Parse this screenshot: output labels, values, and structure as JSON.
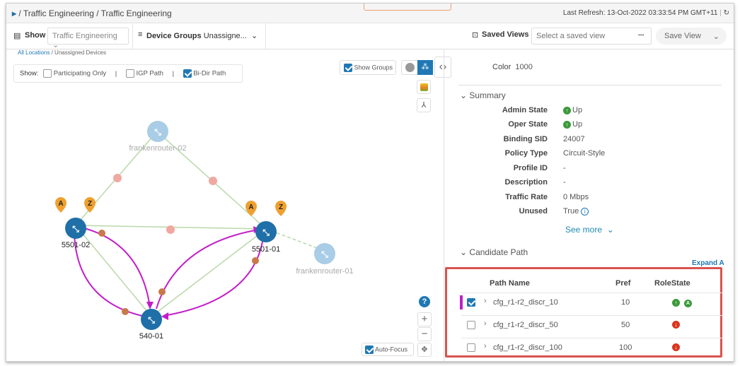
{
  "header": {
    "breadcrumb": "/ Traffic Engineering / Traffic Engineering",
    "last_refresh": "Last Refresh: 13-Oct-2022 03:33:54 PM GMT+11"
  },
  "toolbar": {
    "show_label": "Show",
    "show_value": "Traffic Engineering",
    "groups_label": "Device Groups",
    "groups_value": "Unassigne...",
    "saved_views_label": "Saved Views",
    "saved_view_placeholder": "Select a saved view",
    "more": "•••",
    "save_view": "Save View"
  },
  "location": {
    "root": "All Locations",
    "current": "/ Unassigned Devices"
  },
  "filters": {
    "label": "Show:",
    "items": [
      {
        "label": "Participating Only",
        "checked": false
      },
      {
        "label": "IGP Path",
        "checked": false
      },
      {
        "label": "Bi-Dir Path",
        "checked": true
      }
    ]
  },
  "map": {
    "show_groups": "Show Groups",
    "show_groups_checked": true,
    "auto_focus": "Auto-Focus",
    "auto_focus_checked": true,
    "help": "?",
    "zoom_in": "+",
    "zoom_out": "−",
    "nodes": [
      {
        "name": "frankenrouter-02",
        "status": "unreachable"
      },
      {
        "name": "5501-02",
        "markers": [
          "A",
          "Z"
        ]
      },
      {
        "name": "5501-01",
        "markers": [
          "A",
          "Z"
        ]
      },
      {
        "name": "frankenrouter-01",
        "status": "unreachable"
      },
      {
        "name": "540-01"
      }
    ],
    "colors": {
      "path": "#c21ec8",
      "link": "#b9d8a8",
      "node": "#1f6fa8",
      "node_dim": "#a9cde6",
      "marker": "#f0a030",
      "link_down": "#f0a8a0"
    }
  },
  "detail": {
    "color_label": "Color",
    "color_value": "1000",
    "summary_title": "Summary",
    "summary": [
      {
        "k": "Admin State",
        "v": "Up",
        "icon": "up"
      },
      {
        "k": "Oper State",
        "v": "Up",
        "icon": "up"
      },
      {
        "k": "Binding SID",
        "v": "24007"
      },
      {
        "k": "Policy Type",
        "v": "Circuit-Style"
      },
      {
        "k": "Profile ID",
        "v": "-"
      },
      {
        "k": "Description",
        "v": "-"
      },
      {
        "k": "Traffic Rate",
        "v": "0 Mbps"
      },
      {
        "k": "Unused",
        "v": "True",
        "icon": "info"
      }
    ],
    "see_more": "See more",
    "candidate_title": "Candidate Path",
    "expand_all": "Expand A",
    "columns": [
      "Path Name",
      "Pref",
      "RoleState"
    ],
    "rows": [
      {
        "name": "cfg_r1-r2_discr_10",
        "pref": "10",
        "checked": true,
        "state": [
          "up",
          "active"
        ],
        "active_letter": "A"
      },
      {
        "name": "cfg_r1-r2_discr_50",
        "pref": "50",
        "checked": false,
        "state": [
          "down"
        ]
      },
      {
        "name": "cfg_r1-r2_discr_100",
        "pref": "100",
        "checked": false,
        "state": [
          "down"
        ]
      }
    ]
  }
}
